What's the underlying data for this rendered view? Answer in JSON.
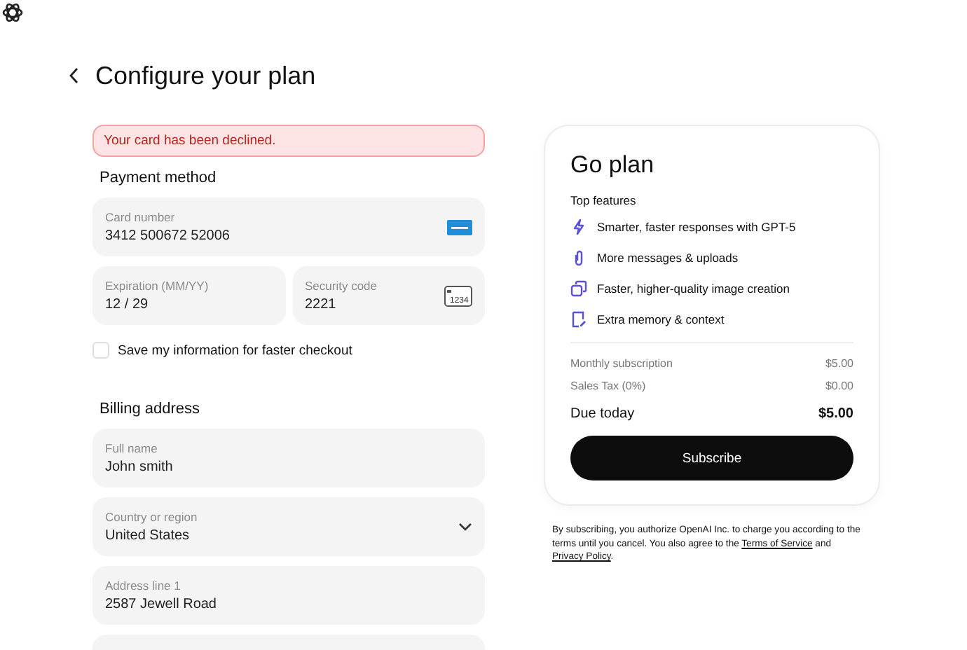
{
  "header": {
    "title": "Configure your plan"
  },
  "payment": {
    "error": "Your card has been declined.",
    "heading": "Payment method",
    "card": {
      "label": "Card number",
      "value": "3412 500672 52006"
    },
    "expiration": {
      "label": "Expiration (MM/YY)",
      "value": "12 / 29"
    },
    "security": {
      "label": "Security code",
      "value": "2221",
      "icon_text": "1234"
    },
    "save": {
      "label": "Save my information for faster checkout",
      "checked": false
    }
  },
  "billing": {
    "heading": "Billing address",
    "fields": [
      {
        "kind": "text",
        "label": "Full name",
        "value": "John smith"
      },
      {
        "kind": "select",
        "label": "Country or region",
        "value": "United States"
      },
      {
        "kind": "text",
        "label": "Address line 1",
        "value": "2587 Jewell Road"
      },
      {
        "kind": "partial"
      }
    ]
  },
  "plan": {
    "title": "Go plan",
    "features_heading": "Top features",
    "features": [
      {
        "kind": "spark",
        "text": "Smarter, faster responses with GPT-5"
      },
      {
        "kind": "clip",
        "text": "More messages & uploads"
      },
      {
        "kind": "image",
        "text": "Faster, higher-quality image creation"
      },
      {
        "kind": "memory",
        "text": "Extra memory & context"
      }
    ],
    "lines": [
      {
        "label": "Monthly subscription",
        "amount": "$5.00",
        "total": false
      },
      {
        "label": "Sales Tax (0%)",
        "amount": "$0.00",
        "total": false
      },
      {
        "label": "Due today",
        "amount": "$5.00",
        "total": true
      }
    ],
    "button": "Subscribe"
  },
  "legal": {
    "before": "By subscribing, you authorize OpenAI Inc. to charge you according to the terms until you cancel. You also agree to the ",
    "terms": "Terms of Service",
    "and": " and ",
    "privacy": "Privacy Policy",
    "end": "."
  }
}
